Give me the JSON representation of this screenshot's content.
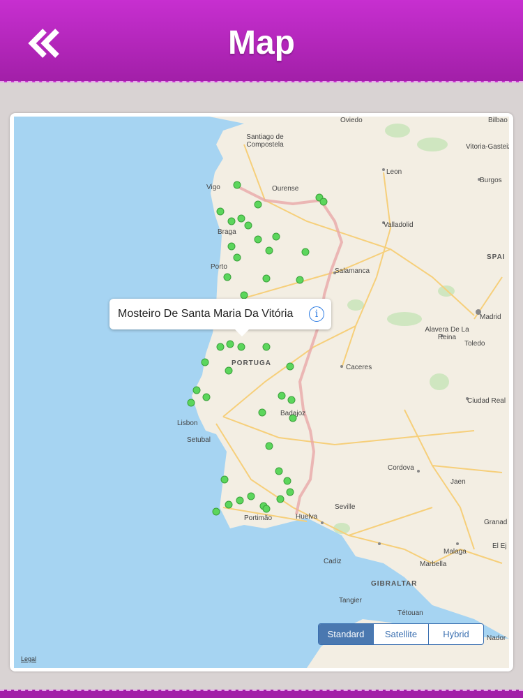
{
  "header": {
    "title": "Map",
    "back_icon": "double-chevron-left-icon"
  },
  "map": {
    "labels": {
      "oviedo": "Oviedo",
      "bilbao": "Bilbao",
      "santiago": "Santiago de Compostela",
      "vitoria": "Vitoria-Gasteiz",
      "leon": "Leon",
      "vigo": "Vigo",
      "ourense": "Ourense",
      "burgos": "Burgos",
      "braga": "Braga",
      "valladolid": "Valladolid",
      "porto": "Porto",
      "spain": "SPAI",
      "salamanca": "Salamanca",
      "madrid": "Madrid",
      "alavera": "Alavera De La Reina",
      "toledo": "Toledo",
      "portugal": "PORTUGA",
      "caceres": "Caceres",
      "ciudad_real": "Ciudad Real",
      "badajoz": "Badajoz",
      "lisbon": "Lisbon",
      "setubal": "Setubal",
      "cordova": "Cordova",
      "jaen": "Jaen",
      "seville": "Seville",
      "faro": "Portimão",
      "huelva": "Huelva",
      "granada": "Granad",
      "malaga": "Malaga",
      "cadiz": "Cadiz",
      "marbella": "Marbella",
      "gibraltar": "GIBRALTAR",
      "tangier": "Tangier",
      "tetouan": "Tétouan",
      "nador": "Nador",
      "el_ejido": "El Ej"
    },
    "callout": {
      "text": "Mosteiro De Santa Maria Da Vitória",
      "info_icon": "info-icon"
    },
    "map_types": [
      "Standard",
      "Satellite",
      "Hybrid"
    ],
    "selected_map_type": "Standard",
    "legal": "Legal",
    "colors": {
      "sea": "#a6d4f2",
      "land": "#f3eee3",
      "pin": "#5cd65c",
      "border": "#e9a7a7",
      "road": "#f6cf7a"
    }
  }
}
